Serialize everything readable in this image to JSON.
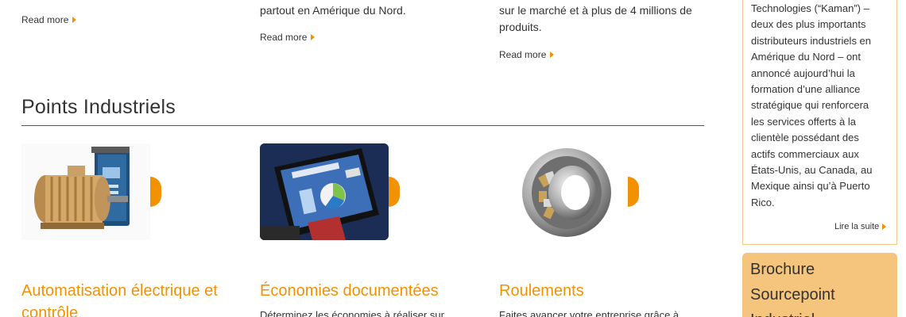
{
  "top_columns": [
    {
      "text": "",
      "read_more": "Read more"
    },
    {
      "text": "partout en Amérique du Nord.",
      "read_more": "Read more"
    },
    {
      "text": "sur le marché et à plus de 4 millions de produits.",
      "read_more": "Read more"
    }
  ],
  "section": {
    "title": "Points Industriels"
  },
  "cards": [
    {
      "image_icon": "motor-drive-image",
      "title": "Automatisation électrique et contrôle",
      "desc": ""
    },
    {
      "image_icon": "tablet-report-image",
      "title": "Économies documentées",
      "desc": "Déterminez les économies à réaliser sur"
    },
    {
      "image_icon": "bearing-image",
      "title": "Roulements",
      "desc": "Faites avancer votre entreprise grâce à"
    }
  ],
  "sidebar": {
    "news_text": "Technologies (“Kaman”) – deux des plus importants distributeurs industriels en Amérique du Nord – ont annoncé aujourd’hui la formation d’une alliance stratégique qui renforcera les services offerts à la clientèle possédant des actifs commerciaux aux États-Unis, au Canada, au Mexique ainsi qu’à Puerto Rico.",
    "news_lines": [
      "Technologies (“Kaman”) –",
      "deux des plus importants",
      "distributeurs industriels en",
      "Amérique du Nord – ont",
      "annoncé aujourd’hui la",
      "formation d’une alliance",
      "stratégique qui renforcera",
      "les services offerts à la",
      "clientèle possédant des",
      "actifs commerciaux aux",
      "États-Unis, au Canada, au",
      "Mexique ainsi qu’à Puerto",
      "Rico."
    ],
    "read_link": "Lire la suite",
    "brochure_lines": [
      "Brochure",
      "Sourcepoint",
      "Industriel"
    ]
  },
  "colors": {
    "accent": "#f39200",
    "brochure_bg": "#f5c57e",
    "sidebar_border": "#f2c98a"
  }
}
